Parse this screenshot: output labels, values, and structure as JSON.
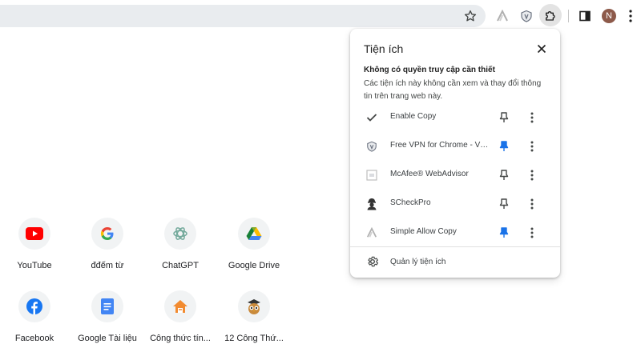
{
  "toolbar": {
    "avatar_initial": "N",
    "icons": [
      "bookmark-star-icon",
      "simple-allow-copy-icon",
      "vpn-shield-icon",
      "extensions-puzzle-icon",
      "side-panel-icon",
      "profile-avatar",
      "menu-icon"
    ]
  },
  "shortcuts": [
    {
      "label": "YouTube",
      "icon": "youtube-icon"
    },
    {
      "label": "đđếm từ",
      "icon": "google-icon"
    },
    {
      "label": "ChatGPT",
      "icon": "chatgpt-icon"
    },
    {
      "label": "Google Drive",
      "icon": "google-drive-icon"
    },
    {
      "label": "Facebook",
      "icon": "facebook-icon"
    },
    {
      "label": "Google Tài liệu",
      "icon": "google-docs-icon"
    },
    {
      "label": "Công thức tín...",
      "icon": "house-icon"
    },
    {
      "label": "12 Công Thứ...",
      "icon": "owl-icon"
    }
  ],
  "extensions_panel": {
    "title": "Tiện ích",
    "section_heading": "Không có quyền truy cập cần thiết",
    "section_desc": "Các tiện ích này không cần xem và thay đổi thông tin trên trang web này.",
    "items": [
      {
        "name": "Enable Copy",
        "icon": "checkmark-icon",
        "pinned": false
      },
      {
        "name": "Free VPN for Chrome - VPN Proxy VeePN",
        "icon": "vpn-shield-icon",
        "pinned": true
      },
      {
        "name": "McAfee® WebAdvisor",
        "icon": "mcafee-icon",
        "pinned": false
      },
      {
        "name": "SCheckPro",
        "icon": "scheckpro-icon",
        "pinned": false
      },
      {
        "name": "Simple Allow Copy",
        "icon": "simple-allow-copy-icon",
        "pinned": true
      }
    ],
    "manage_label": "Quản lý tiện ích"
  },
  "colors": {
    "pinned": "#1a73e8",
    "unpinned": "#444746",
    "accent_red": "#ff0000"
  }
}
